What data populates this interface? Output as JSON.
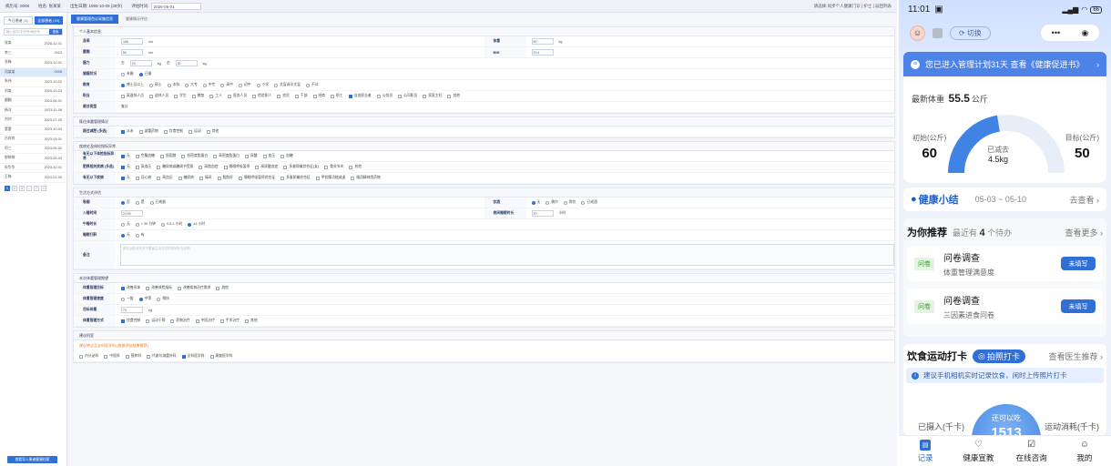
{
  "desktop": {
    "topbar": {
      "fields": [
        {
          "label": "病历号: 0008",
          "value": ""
        },
        {
          "label": "姓名: 张某某",
          "value": ""
        },
        {
          "label": "出生日期: 1985-10-09 (38岁)",
          "value": ""
        },
        {
          "label": "评估时间:",
          "value": "2026-06-01"
        }
      ],
      "right_text": "请选择·同步个人健康门诊 | 护士 | 返回列表"
    },
    "left": {
      "tabs": [
        "今日患者 (1)",
        "全部患者 (20)"
      ],
      "search_placeholder": "输入姓名/手机号/病历号",
      "search_button": "搜索",
      "rows": [
        {
          "name": "张某",
          "date": "2026-12-01"
        },
        {
          "name": "李三",
          "date": "2023"
        },
        {
          "name": "张梅",
          "date": "2023-10-01"
        },
        {
          "name": "冯某某",
          "date": "0008"
        },
        {
          "name": "朱伟",
          "date": "2023-10-02"
        },
        {
          "name": "刘某",
          "date": "2000-10-24"
        },
        {
          "name": "翻翻",
          "date": "2023-06-01"
        },
        {
          "name": "杨洋",
          "date": "2023-11-08"
        },
        {
          "name": "刘刘",
          "date": "2023-07-05"
        },
        {
          "name": "董董",
          "date": "2023-10-03"
        },
        {
          "name": "吕宾宾",
          "date": "2023-09-01"
        },
        {
          "name": "阿三",
          "date": "2023-05-02"
        },
        {
          "name": "郁郁郁",
          "date": "2023-06-03"
        },
        {
          "name": "祝华华",
          "date": "2023-10-01"
        },
        {
          "name": "王梅",
          "date": "2023-02-05"
        }
      ],
      "pager": [
        "1",
        "2",
        "3",
        "...",
        "7",
        ">"
      ],
      "bottom_button": "查看导入患者健康档案"
    },
    "main": {
      "tabs": [
        "健康管理首诊采集信息",
        "健康情况评估"
      ],
      "sections": {
        "basic": {
          "title": "个人基本信息",
          "height_label": "身高",
          "height_val": "166",
          "height_unit": "cm",
          "weight_label": "体重",
          "weight_val": "60",
          "weight_unit": "kg",
          "waist_label": "腰围",
          "waist_val": "80",
          "waist_unit": "cm",
          "bmi_label": "BMI",
          "bmi_val": "23.4",
          "grip_label": "握力",
          "grip_left": "左",
          "grip_left_val": "20",
          "grip_right": "右",
          "grip_right_val": "30",
          "grip_unit": "kg",
          "marital_label": "婚姻状况",
          "marital_opts": [
            "未婚",
            "已婚"
          ],
          "edu_label": "教育",
          "edu_opts": [
            "博士及以上",
            "硕士",
            "本科",
            "大专",
            "中专",
            "高中",
            "初中",
            "小学",
            "文盲或半文盲",
            "不详"
          ],
          "job_label": "职业",
          "job_opts": [
            "离退休人员",
            "退休人员",
            "学生",
            "教育",
            "工人",
            "医务人员",
            "检验职人",
            "农民",
            "干部",
            "经商",
            "职工",
            "自由职业者",
            "公务员",
            "公司职员",
            "家庭主妇",
            "其他"
          ],
          "visit_label": "就诊类型",
          "visit_val": "复诊"
        },
        "history": {
          "title": "既往体重管理情况",
          "lab": "既往减肥 (多选)",
          "opts": [
            "从未",
            "减重药物",
            "饮食控制",
            "运动",
            "其他"
          ]
        },
        "disease": {
          "title": "疾病史及体检指标异常",
          "r1_lab": "有无以下体检指标异常",
          "r1_opts": [
            "无",
            "空腹血糖",
            "胆固醇",
            "低密度脂蛋白",
            "高密度脂蛋白",
            "尿酸",
            "血压",
            "血糖"
          ],
          "r2_lab": "肥胖相关疾病 (多选)",
          "r2_opts": [
            "无",
            "高血压",
            "糖尿病或糖调节受损",
            "高脂血症",
            "睡眠呼吸暂停",
            "高尿酸血症",
            "多囊卵巢综合征(女)",
            "骨关节炎",
            "其他"
          ],
          "r3_lab": "有无以下疾病",
          "r3_opts": [
            "无",
            "冠心病",
            "高血压",
            "糖尿病",
            "痛风",
            "脂肪肝",
            "睡眠呼吸暂停综合征",
            "多囊卵巢综合征",
            "甲状腺功能减退",
            "服用精神类药物"
          ]
        },
        "life": {
          "title": "生活方式评估",
          "smoke_lab": "吸烟",
          "smoke_opts": [
            "否",
            "是",
            "已戒烟"
          ],
          "drink_lab": "饮酒",
          "drink_opts": [
            "无",
            "偶尔",
            "常饮",
            "已戒酒"
          ],
          "sleep_lab": "入睡时间",
          "sleep_val": "22:00",
          "sleepdur_lab": "夜间睡眠时长",
          "sleepdur_val": "10",
          "sleepdur_unit": "小时",
          "nap_lab": "午睡时长",
          "nap_opts": [
            "无",
            "< 30 分钟",
            "0.5-1 小时",
            "≥1 小时"
          ],
          "snore_lab": "睡眠打鼾",
          "snore_opts": [
            "无",
            "有"
          ],
          "note_lab": "备注",
          "note_ph": "请在此处填写关于患者生活方式的其他补充说明"
        },
        "goal": {
          "title": "本次体重管理期望",
          "g1_lab": "体重管理目标",
          "g1_opts": [
            "改善形体",
            "改善体检指标",
            "改善疾病治疗需求",
            "其他"
          ],
          "g2_lab": "体重管理速度",
          "g2_opts": [
            "一般",
            "中等",
            "稍快"
          ],
          "g3_lab": "目标体重",
          "g3_val": "70",
          "g3_unit": "kg",
          "g4_lab": "体重管理方式",
          "g4_opts": [
            "饮食控制",
            "运动干预",
            "药物治疗",
            "中医治疗",
            "手术治疗",
            "其他"
          ]
        },
        "advice": {
          "title": "建议科室",
          "warn": "建议转诊至全科医学科 (根据评估结果推荐)",
          "opts": [
            "内分泌科",
            "中医科",
            "营养科",
            "代谢与减重外科",
            "全科医学科",
            "康复医学科"
          ]
        }
      }
    }
  },
  "phone": {
    "time": "11:01",
    "battery": "66",
    "switch_label": "切换",
    "banner": "您已进入管理计划31天 查看《健康促进书》",
    "latest_label": "最新体重",
    "latest_val": "55.5",
    "latest_unit": "公斤",
    "init_label": "初始(公斤)",
    "init_val": "60",
    "target_label": "目标(公斤)",
    "target_val": "50",
    "lost_label": "已减去",
    "lost_val": "4.5kg",
    "lost_progress": 0.45,
    "summary_title": "健康小结",
    "summary_date": "05-03 ~ 05-10",
    "summary_go": "去查看",
    "rec_title": "为你推荐",
    "rec_count_pre": "最近有",
    "rec_count": "4",
    "rec_count_post": "个待办",
    "rec_more": "查看更多",
    "rec_items": [
      {
        "tag": "问卷",
        "title": "问卷调查",
        "sub": "体重管理满意度",
        "btn": "未填写"
      },
      {
        "tag": "问卷",
        "title": "问卷调查",
        "sub": "三因素进食问卷",
        "btn": "未填写"
      }
    ],
    "diet_title": "饮食运动打卡",
    "diet_btn": "拍照打卡",
    "diet_doc": "查看医生推荐",
    "diet_tip": "建议手机相机实时记录饮食，闲时上传照片打卡",
    "intake_label": "已摄入(千卡)",
    "burn_label": "运动消耗(千卡)",
    "remain_label": "还可以吃",
    "remain_val": "1513",
    "tabs": [
      "记录",
      "健康宣教",
      "在线咨询",
      "我的"
    ],
    "colors": {
      "accent": "#2f6fd6",
      "banner": "#4d82e6",
      "tag_green": "#3c9a2e"
    }
  }
}
